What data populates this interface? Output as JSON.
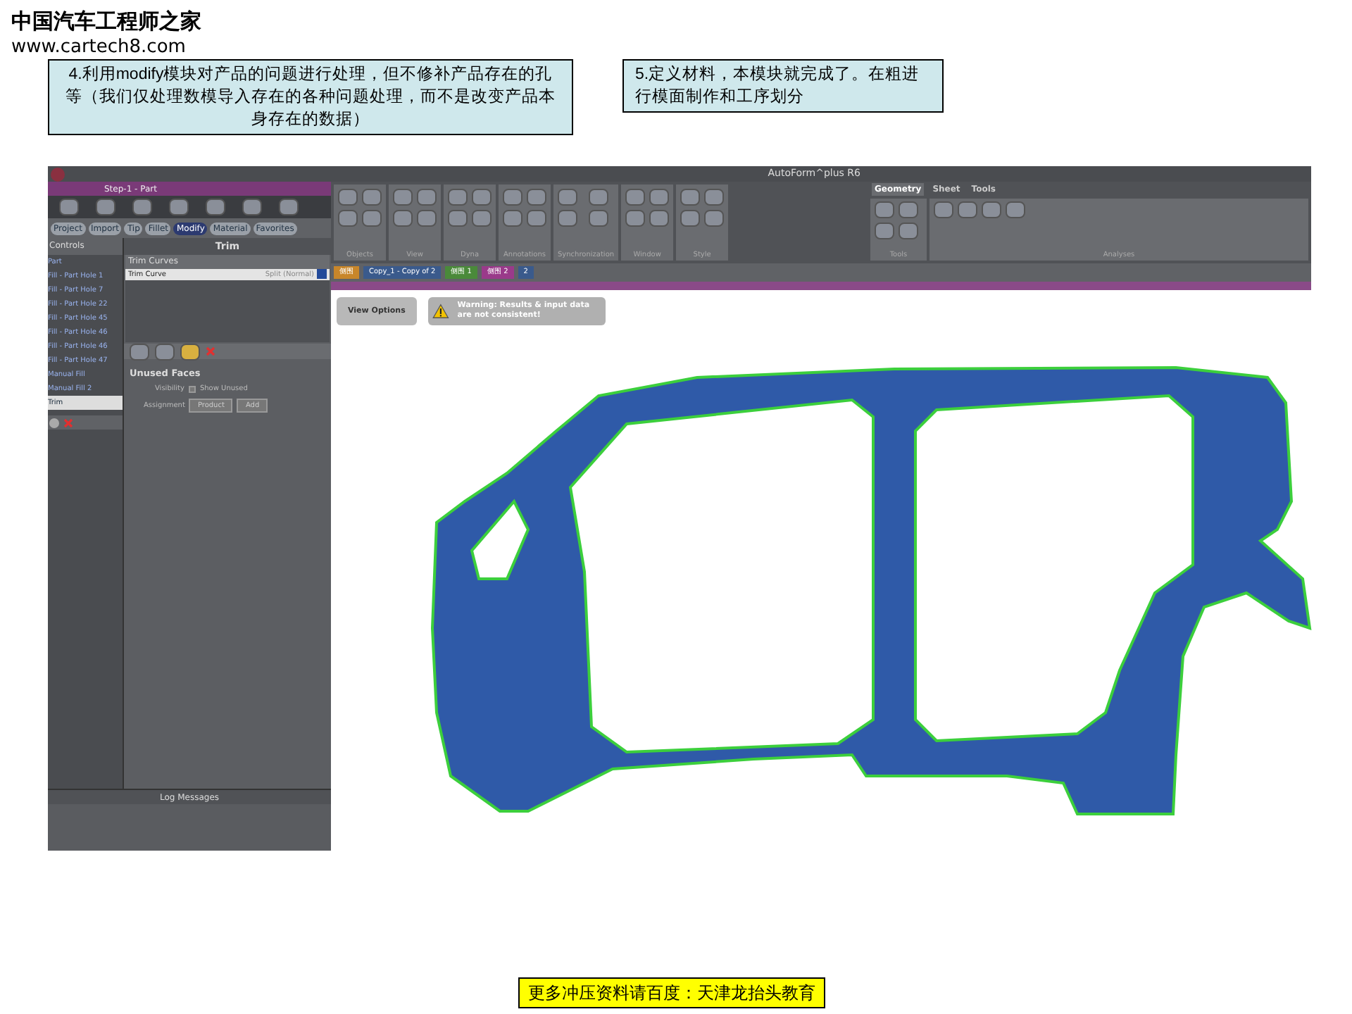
{
  "logo": {
    "title": "中国汽车工程师之家",
    "url": "www.cartech8.com"
  },
  "callouts": [
    "4.利用modify模块对产品的问题进行处理，但不修补产品存在的孔等（我们仅处理数模导入存在的各种问题处理，而不是改变产品本身存在的数据）",
    "5.定义材料，本模块就完成了。在粗进行模面制作和工序划分"
  ],
  "app": {
    "title": "AutoForm^plus R6",
    "panel_title": "Step-1 - Part",
    "module_tabs": [
      {
        "label": "Project",
        "selected": false
      },
      {
        "label": "Import",
        "selected": false
      },
      {
        "label": "Tip",
        "selected": false
      },
      {
        "label": "Fillet",
        "selected": false
      },
      {
        "label": "Modify",
        "selected": true
      },
      {
        "label": "Material",
        "selected": false
      },
      {
        "label": "Favorites",
        "selected": false
      }
    ],
    "tree_header": "Controls",
    "tree_items": [
      {
        "label": "Part",
        "selected": false
      },
      {
        "label": "Fill - Part Hole 1",
        "selected": false
      },
      {
        "label": "Fill - Part Hole 7",
        "selected": false
      },
      {
        "label": "Fill - Part Hole 22",
        "selected": false
      },
      {
        "label": "Fill - Part Hole 45",
        "selected": false
      },
      {
        "label": "Fill - Part Hole 46",
        "selected": false
      },
      {
        "label": "Fill - Part Hole 46",
        "selected": false
      },
      {
        "label": "Fill - Part Hole 47",
        "selected": false
      },
      {
        "label": "Manual Fill",
        "selected": false
      },
      {
        "label": "Manual Fill 2",
        "selected": false
      },
      {
        "label": "Trim",
        "selected": true
      }
    ],
    "trim": {
      "title": "Trim",
      "list_header": "Trim Curves",
      "row": {
        "name": "Trim Curve",
        "mode": "Split (Normal)"
      },
      "section": "Unused Faces",
      "visibility_label": "Visibility",
      "visibility_option": "Show Unused",
      "visibility_checked": false,
      "assignment_label": "Assignment",
      "assign_buttons": [
        "Product",
        "Add"
      ]
    },
    "log_title": "Log Messages",
    "ribbon_groups": [
      "Objects",
      "View",
      "Dyna",
      "Annotations",
      "Synchronization",
      "Window",
      "Style"
    ],
    "right_tabs": [
      {
        "label": "Geometry",
        "selected": true
      },
      {
        "label": "Sheet",
        "selected": false
      },
      {
        "label": "Tools",
        "selected": false
      }
    ],
    "right_groups": [
      "Tools",
      "Analyses"
    ],
    "doc_tabs": [
      {
        "label": "侧围",
        "color": "#c8862a"
      },
      {
        "label": "Copy_1 - Copy of 2",
        "color": "#3a5a8c"
      },
      {
        "label": "侧围 1",
        "color": "#4a8a3a"
      },
      {
        "label": "侧围 2",
        "color": "#9a3a8a"
      },
      {
        "label": "2",
        "color": "#3a5a8c"
      }
    ],
    "view_options": "View Options",
    "warning": "Warning: Results & input data are not consistent!"
  },
  "footer": "更多冲压资料请百度：天津龙抬头教育"
}
